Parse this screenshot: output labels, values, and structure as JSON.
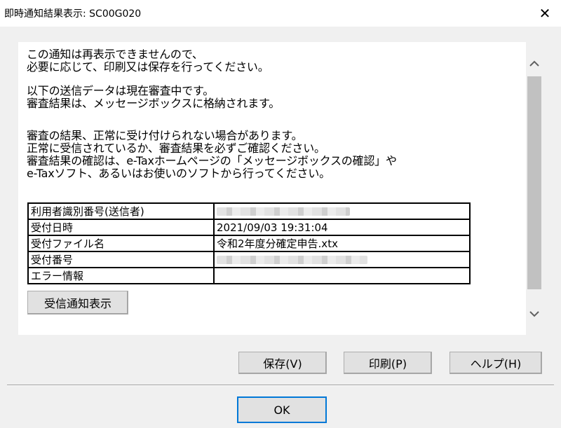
{
  "window": {
    "title": "即時通知結果表示: SC00G020",
    "close_label": "✕"
  },
  "messages": {
    "block1": [
      "この通知は再表示できませんので、",
      "必要に応じて、印刷又は保存を行ってください。"
    ],
    "block2": [
      "以下の送信データは現在審査中です。",
      "審査結果は、メッセージボックスに格納されます。"
    ],
    "block3": [
      "審査の結果、正常に受け付けられない場合があります。",
      "正常に受信されているか、審査結果を必ずご確認ください。",
      "審査結果の確認は、e-Taxホームページの「メッセージボックスの確認」や",
      "e-Taxソフト、あるいはお使いのソフトから行ってください。"
    ]
  },
  "info_table": {
    "rows": [
      {
        "label": "利用者識別番号(送信者)",
        "value": ""
      },
      {
        "label": "受付日時",
        "value": "2021/09/03 19:31:04"
      },
      {
        "label": "受付ファイル名",
        "value": "令和2年度分確定申告.xtx"
      },
      {
        "label": "受付番号",
        "value": ""
      },
      {
        "label": "エラー情報",
        "value": ""
      }
    ]
  },
  "buttons": {
    "receive_notice": "受信通知表示",
    "save": "保存(V)",
    "print": "印刷(P)",
    "help": "ヘルプ(H)",
    "ok": "OK"
  },
  "scrollbar": {
    "up_icon": "chevron-up-icon",
    "down_icon": "chevron-down-icon"
  }
}
